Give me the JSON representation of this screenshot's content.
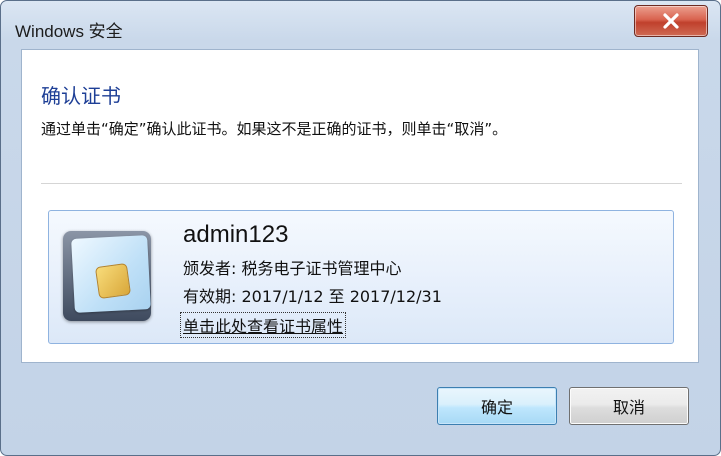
{
  "window": {
    "title": "Windows 安全"
  },
  "dialog": {
    "heading": "确认证书",
    "description": "通过单击“确定”确认此证书。如果这不是正确的证书，则单击“取消”。"
  },
  "certificate": {
    "name": "admin123",
    "issuer": "颁发者: 税务电子证书管理中心",
    "validity": "有效期: 2017/1/12 至 2017/12/31",
    "properties_link": "单击此处查看证书属性",
    "icon": "smart-card-icon"
  },
  "buttons": {
    "ok": "确定",
    "cancel": "取消"
  },
  "colors": {
    "heading": "#1e3f96",
    "close_button": "#c0402c",
    "frame": "#c9d8ea"
  }
}
